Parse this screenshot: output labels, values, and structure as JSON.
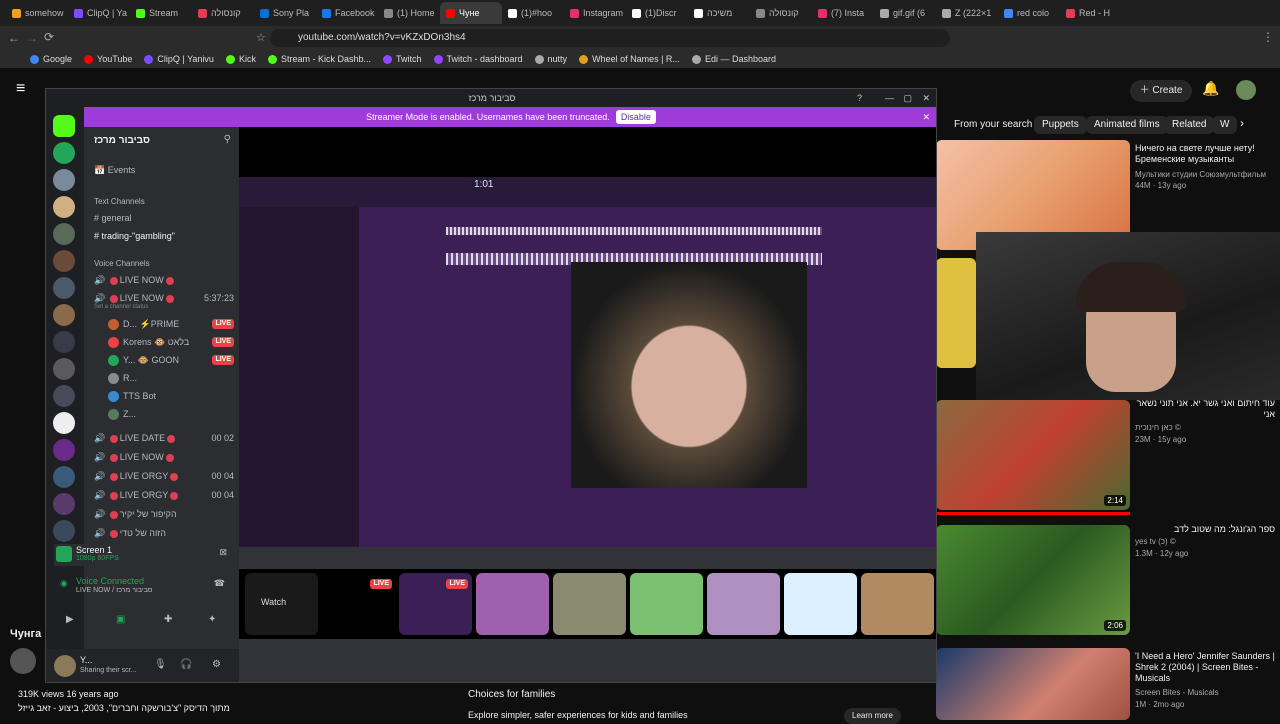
{
  "browser": {
    "tabs": [
      {
        "label": "somehow",
        "color": "#f0a020"
      },
      {
        "label": "ClipQ | Ya",
        "color": "#7b4dff"
      },
      {
        "label": "Stream",
        "color": "#53fc18"
      },
      {
        "label": "קונסולה",
        "color": "#e03e52"
      },
      {
        "label": "Sony Pla",
        "color": "#0070d1"
      },
      {
        "label": "Facebook",
        "color": "#1877f2"
      },
      {
        "label": "(1) Home",
        "color": "#888888"
      },
      {
        "label": "Чуне",
        "color": "#ff0000",
        "active": true
      },
      {
        "label": "(1)#hoo",
        "color": "#ffffff"
      },
      {
        "label": "Instagram",
        "color": "#e1306c"
      },
      {
        "label": "(1)Discr",
        "color": "#ffffff"
      },
      {
        "label": "משיכה",
        "color": "#ffffff"
      },
      {
        "label": "קונסולה",
        "color": "#888888"
      },
      {
        "label": "(7) Insta",
        "color": "#e1306c"
      },
      {
        "label": "gif.gif (6",
        "color": "#aaaaaa"
      },
      {
        "label": "Z (222×1",
        "color": "#aaaaaa"
      },
      {
        "label": "red colo",
        "color": "#4285f4"
      },
      {
        "label": "Red - H",
        "color": "#e03e52"
      }
    ],
    "url": "youtube.com/watch?v=vKZxDOn3hs4",
    "bookmarks": [
      {
        "label": "Google",
        "color": "#4285f4"
      },
      {
        "label": "YouTube",
        "color": "#ff0000"
      },
      {
        "label": "ClipQ | Yanivu",
        "color": "#7b4dff"
      },
      {
        "label": "Kick",
        "color": "#53fc18"
      },
      {
        "label": "Stream - Kick Dashb...",
        "color": "#53fc18"
      },
      {
        "label": "Twitch",
        "color": "#9146ff"
      },
      {
        "label": "Twitch - dashboard",
        "color": "#9146ff"
      },
      {
        "label": "nutty",
        "color": "#aaaaaa"
      },
      {
        "label": "Wheel of Names | R...",
        "color": "#e0a020"
      },
      {
        "label": "Edi — Dashboard",
        "color": "#aaaaaa"
      }
    ]
  },
  "youtube": {
    "create_label": "Create",
    "chips": [
      "From your search",
      "Puppets",
      "Animated films",
      "Related",
      "W"
    ],
    "videos": [
      {
        "title": "Ничего на свете лучше нету! Бременские музыканты",
        "channel": "Мультики студии Союзмультфильм",
        "meta": "44M · 13y ago",
        "duration": ""
      },
      {
        "title": "",
        "channel": "",
        "meta": "",
        "duration": ""
      },
      {
        "title": "עוד חיתום ואני גשר יא. אני תוני נשאר אני",
        "channel": "כאן חינוכית ©",
        "meta": "23M · 15y ago",
        "duration": "2:14"
      },
      {
        "title": "ספר הג'ונגל: מה שטוב לדב",
        "channel": "yes tv (כ) ©",
        "meta": "1.3M · 12y ago",
        "duration": "2:06"
      },
      {
        "title": "'I Need a Hero' Jennifer Saunders | Shrek 2 (2004) | Screen Bites - Musicals",
        "channel": "Screen Bites - Musicals",
        "meta": "1M · 2mo ago",
        "duration": ""
      }
    ],
    "below_title": "Чунга",
    "views": "319K views  16 years ago",
    "desc": "מתוך הדיסק \"צ'בורשקה וחברים\", 2003, ביצוע - זאב גייזל",
    "choices_title": "Choices for families",
    "choices_desc": "Explore simpler, safer experiences for kids and families",
    "learn_more": "Learn more"
  },
  "discord": {
    "window_title": "סביבור מרכז",
    "streamer_msg": "Streamer Mode is enabled. Usernames have been truncated.",
    "disable_label": "Disable",
    "server_name": "סביבור מרכז",
    "events_label": "Events",
    "text_channels_label": "Text Channels",
    "text_channels": [
      "general",
      "trading-\"gambling\""
    ],
    "voice_channels_label": "Voice Channels",
    "voice_channels": [
      {
        "name": "LIVE NOW",
        "right": ""
      },
      {
        "name": "LIVE NOW",
        "right": "5:37:23",
        "status": "Set a channel status"
      },
      {
        "name": "LIVE DATE",
        "right": "00  02"
      },
      {
        "name": "LIVE NOW",
        "right": ""
      },
      {
        "name": "LIVE ORGY",
        "right": "00  04"
      },
      {
        "name": "LIVE ORGY",
        "right": "00  04"
      },
      {
        "name": "הקיפור של יקיר",
        "right": ""
      },
      {
        "name": "הזוה של טדי",
        "right": ""
      }
    ],
    "members": [
      {
        "name": "D... ⚡PRIME",
        "live": "LIVE"
      },
      {
        "name": "Korens 🐵 בלאט",
        "live": "LIVE"
      },
      {
        "name": "Y... 🐵 GOON",
        "live": "LIVE"
      },
      {
        "name": "R...",
        "live": ""
      },
      {
        "name": "TTS Bot",
        "live": ""
      },
      {
        "name": "Z...",
        "live": ""
      }
    ],
    "screen_label": "Screen 1",
    "screen_sub": "1080p 60FPS",
    "voice_connected": "Voice Connected",
    "voice_sub": "LIVE NOW / סביבור מרכז",
    "user_name": "Y...",
    "user_status": "Sharing their scr...",
    "stream_time": "1:01",
    "watch_label": "Watch",
    "tray_live": "LIVE",
    "colors": {
      "accent": "#a03bdb",
      "live": "#ed4245",
      "kick": "#53fc18"
    }
  }
}
